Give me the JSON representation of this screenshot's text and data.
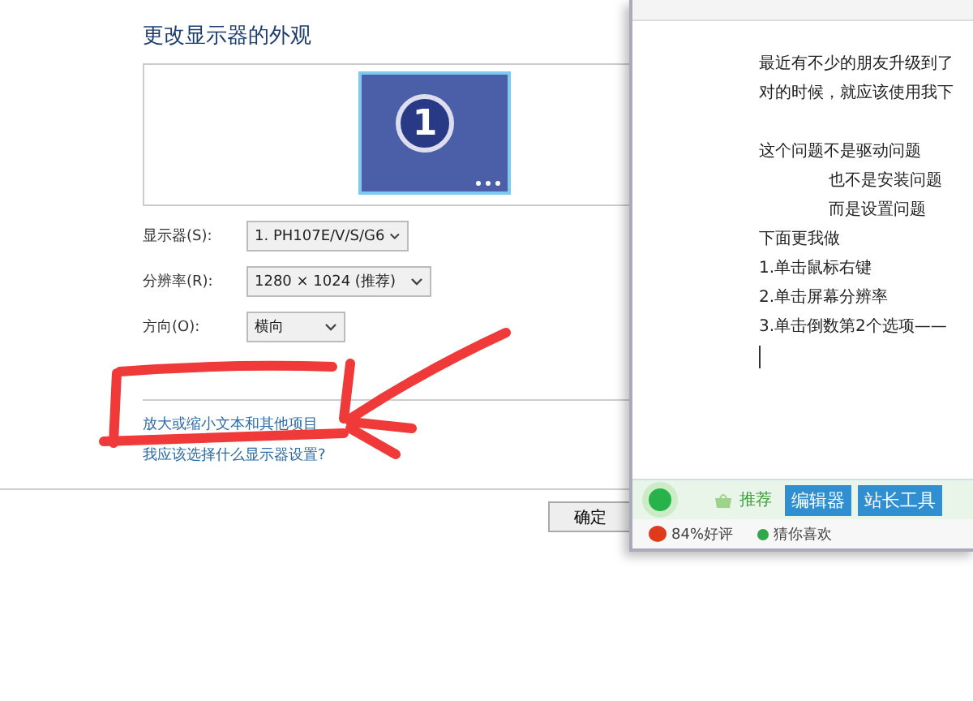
{
  "display_settings": {
    "heading": "更改显示器的外观",
    "monitor_number": "1",
    "fields": [
      {
        "label": "显示器(S):",
        "value": "1. PH107E/V/S/G6"
      },
      {
        "label": "分辨率(R):",
        "value": "1280 × 1024 (推荐)"
      },
      {
        "label": "方向(O):",
        "value": "横向"
      }
    ],
    "links": [
      "放大或缩小文本和其他项目",
      "我应该选择什么显示器设置?"
    ],
    "buttons": [
      "确定"
    ]
  },
  "editor_window": {
    "paragraphs": [
      {
        "lines": [
          {
            "text": "最近有不少的朋友升级到了",
            "indented": false
          },
          {
            "text": "对的时候，就应该使用我下",
            "indented": false
          }
        ]
      },
      {
        "lines": [
          {
            "text": "这个问题不是驱动问题",
            "indented": false
          },
          {
            "text": "也不是安装问题",
            "indented": true
          },
          {
            "text": "而是设置问题",
            "indented": true
          },
          {
            "text": "下面更我做",
            "indented": false
          },
          {
            "text": "1.单击鼠标右键",
            "indented": false
          },
          {
            "text": "2.单击屏幕分辨率",
            "indented": false
          },
          {
            "text": "3.单击倒数第2个选项——",
            "indented": false
          }
        ]
      }
    ],
    "toolbar": {
      "recommend": "推荐",
      "buttons": [
        "编辑器",
        "站长工具"
      ]
    },
    "status": [
      {
        "kind": "tomato",
        "text": "84%好评"
      },
      {
        "kind": "dot",
        "text": "猜你喜欢"
      }
    ]
  }
}
